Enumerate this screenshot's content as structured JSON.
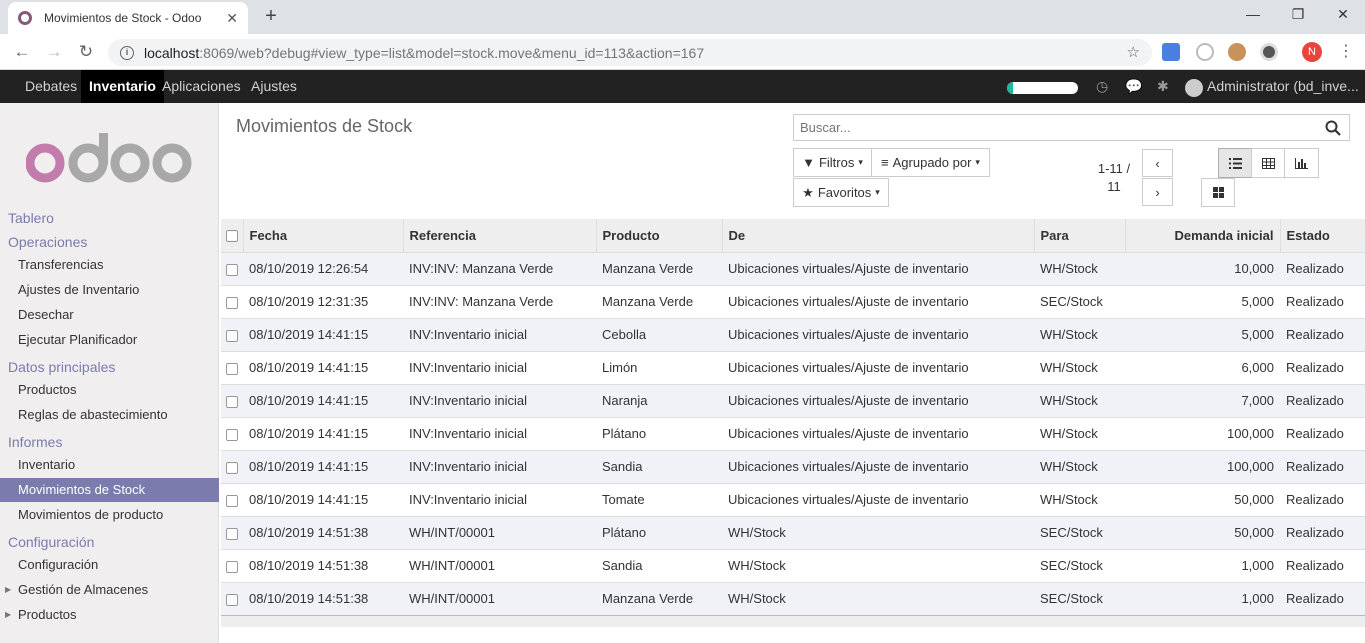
{
  "browser": {
    "tab_title": "Movimientos de Stock - Odoo",
    "url_host": "localhost",
    "url_rest": ":8069/web?debug#view_type=list&model=stock.move&menu_id=113&action=167",
    "user_initial": "N"
  },
  "topbar": {
    "menus": [
      "Debates",
      "Inventario",
      "Aplicaciones",
      "Ajustes"
    ],
    "active_menu": "Inventario",
    "user": "Administrator (bd_inve..."
  },
  "sidebar": {
    "sections": [
      {
        "title": "Tablero",
        "items": []
      },
      {
        "title": "Operaciones",
        "items": [
          "Transferencias",
          "Ajustes de Inventario",
          "Desechar",
          "Ejecutar Planificador"
        ]
      },
      {
        "title": "Datos principales",
        "items": [
          "Productos",
          "Reglas de abastecimiento"
        ]
      },
      {
        "title": "Informes",
        "items": [
          "Inventario",
          "Movimientos de Stock",
          "Movimientos de producto"
        ]
      },
      {
        "title": "Configuración",
        "items": [
          "Configuración",
          "Gestión de Almacenes",
          "Productos"
        ]
      }
    ],
    "active_item": "Movimientos de Stock"
  },
  "control_panel": {
    "title": "Movimientos de Stock",
    "search_placeholder": "Buscar...",
    "filters_label": "Filtros",
    "groupby_label": "Agrupado por",
    "favorites_label": "Favoritos",
    "pager_value": "1-11 / 11"
  },
  "table": {
    "columns": [
      "Fecha",
      "Referencia",
      "Producto",
      "De",
      "Para",
      "Demanda inicial",
      "Estado"
    ],
    "rows": [
      [
        "08/10/2019 12:26:54",
        "INV:INV: Manzana Verde",
        "Manzana Verde",
        "Ubicaciones virtuales/Ajuste de inventario",
        "WH/Stock",
        "10,000",
        "Realizado"
      ],
      [
        "08/10/2019 12:31:35",
        "INV:INV: Manzana Verde",
        "Manzana Verde",
        "Ubicaciones virtuales/Ajuste de inventario",
        "SEC/Stock",
        "5,000",
        "Realizado"
      ],
      [
        "08/10/2019 14:41:15",
        "INV:Inventario inicial",
        "Cebolla",
        "Ubicaciones virtuales/Ajuste de inventario",
        "WH/Stock",
        "5,000",
        "Realizado"
      ],
      [
        "08/10/2019 14:41:15",
        "INV:Inventario inicial",
        "Limón",
        "Ubicaciones virtuales/Ajuste de inventario",
        "WH/Stock",
        "6,000",
        "Realizado"
      ],
      [
        "08/10/2019 14:41:15",
        "INV:Inventario inicial",
        "Naranja",
        "Ubicaciones virtuales/Ajuste de inventario",
        "WH/Stock",
        "7,000",
        "Realizado"
      ],
      [
        "08/10/2019 14:41:15",
        "INV:Inventario inicial",
        "Plátano",
        "Ubicaciones virtuales/Ajuste de inventario",
        "WH/Stock",
        "100,000",
        "Realizado"
      ],
      [
        "08/10/2019 14:41:15",
        "INV:Inventario inicial",
        "Sandia",
        "Ubicaciones virtuales/Ajuste de inventario",
        "WH/Stock",
        "100,000",
        "Realizado"
      ],
      [
        "08/10/2019 14:41:15",
        "INV:Inventario inicial",
        "Tomate",
        "Ubicaciones virtuales/Ajuste de inventario",
        "WH/Stock",
        "50,000",
        "Realizado"
      ],
      [
        "08/10/2019 14:51:38",
        "WH/INT/00001",
        "Plátano",
        "WH/Stock",
        "SEC/Stock",
        "50,000",
        "Realizado"
      ],
      [
        "08/10/2019 14:51:38",
        "WH/INT/00001",
        "Sandia",
        "WH/Stock",
        "SEC/Stock",
        "1,000",
        "Realizado"
      ],
      [
        "08/10/2019 14:51:38",
        "WH/INT/00001",
        "Manzana Verde",
        "WH/Stock",
        "SEC/Stock",
        "1,000",
        "Realizado"
      ]
    ]
  },
  "colors": {
    "accent": "#7c7bad",
    "topbar": "#222222",
    "odd_row": "#f1f1f8",
    "logo_purple": "#c17cab",
    "logo_grey": "#a8a8a8"
  },
  "progress_fraction": 0.08
}
